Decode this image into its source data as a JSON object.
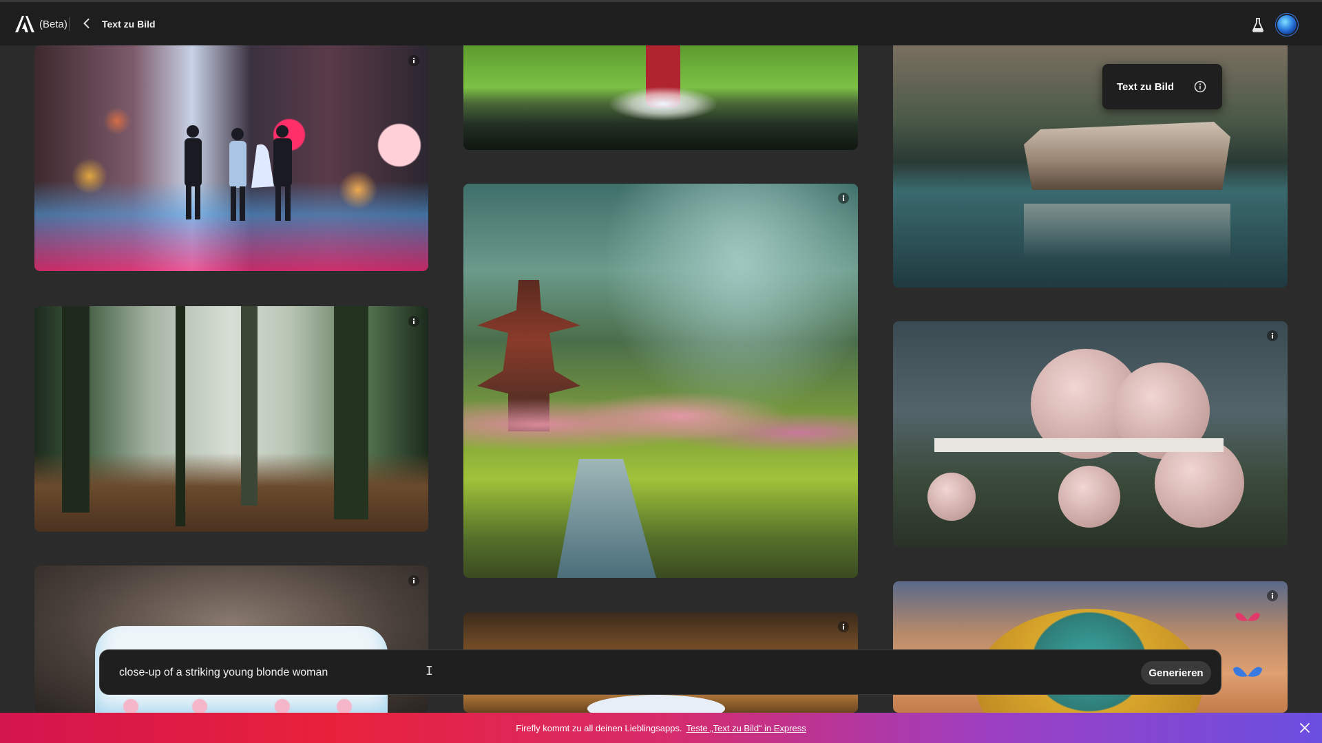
{
  "header": {
    "beta_label": "(Beta)",
    "breadcrumb": "Text zu Bild"
  },
  "tooltip": {
    "title": "Text zu Bild"
  },
  "prompt": {
    "value": "close-up of a striking young blonde woman",
    "generate_label": "Generieren"
  },
  "banner": {
    "text": "Firefly kommt zu all deinen Lieblingsapps.",
    "link_text": "Teste „Text zu Bild“ in Express"
  },
  "gallery": {
    "images": [
      {
        "name": "city-couples-image",
        "column": 1
      },
      {
        "name": "forest-image",
        "column": 1
      },
      {
        "name": "cake-image",
        "column": 1
      },
      {
        "name": "rain-boots-image",
        "column": 2
      },
      {
        "name": "japanese-garden-image",
        "column": 2
      },
      {
        "name": "woman-portrait-image",
        "column": 2
      },
      {
        "name": "lake-house-image",
        "column": 3
      },
      {
        "name": "pink-spheres-house-image",
        "column": 3
      },
      {
        "name": "pumpkin-butterflies-image",
        "column": 3
      }
    ]
  },
  "colors": {
    "background": "#2b2b2b",
    "topbar": "#1e1e1e",
    "banner_start": "#d3154e",
    "banner_end": "#6a4fe0"
  }
}
